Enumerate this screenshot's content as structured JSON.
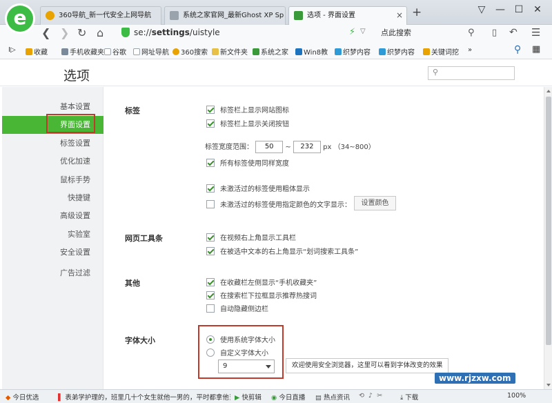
{
  "browser": {
    "logo_letter": "e",
    "tabs": [
      {
        "label": "360导航_新一代安全上网导航",
        "icon_color": "#e8a300"
      },
      {
        "label": "系统之家官网_最新Ghost XP Sp",
        "icon_color": "#9aa3ab"
      },
      {
        "label": "选项 - 界面设置",
        "icon_color": "#3a9a3a"
      }
    ],
    "new_tab_glyph": "+",
    "window_buttons": [
      "▽",
      "—",
      "☐",
      "✕"
    ],
    "address_url_prefix": "se://",
    "address_url_bold": "settings",
    "address_url_suffix": "/uistyle",
    "search_placeholder": "点此搜索"
  },
  "bookmarks": {
    "lead": "I▷",
    "items": [
      {
        "label": "收藏",
        "color": "#e8a300"
      },
      {
        "label": "手机收藏夹",
        "color": "#7a8a9a"
      },
      {
        "label": "谷歌",
        "color": "#9aa3ab"
      },
      {
        "label": "网址导航",
        "color": "#9aa3ab"
      },
      {
        "label": "360搜索",
        "color": "#e8a300"
      },
      {
        "label": "新文件夹",
        "color": "#e8c046"
      },
      {
        "label": "系统之家",
        "color": "#3a9a3a"
      },
      {
        "label": "Win8教",
        "color": "#1e73be"
      },
      {
        "label": "织梦内容",
        "color": "#2e9bd6"
      },
      {
        "label": "织梦内容",
        "color": "#2e9bd6"
      },
      {
        "label": "关键词挖",
        "color": "#e8a300"
      }
    ],
    "more": "»"
  },
  "page": {
    "title": "选项"
  },
  "sidebar": {
    "items": [
      {
        "label": "基本设置"
      },
      {
        "label": "界面设置"
      },
      {
        "label": "标签设置"
      },
      {
        "label": "优化加速"
      },
      {
        "label": "鼠标手势"
      },
      {
        "label": "快捷键"
      },
      {
        "label": "高级设置"
      },
      {
        "label": "实验室"
      },
      {
        "label": "安全设置"
      },
      {
        "label": "广告过滤"
      }
    ],
    "active_index": 1
  },
  "sections": {
    "tabs": {
      "title": "标签",
      "opt1": "标签栏上显示网站图标",
      "opt2": "标签栏上显示关闭按钮",
      "width_label": "标签宽度范围：",
      "width_min": "50",
      "width_sep": "~",
      "width_max": "232",
      "width_unit": "px （34~800）",
      "opt3": "所有标签使用同样宽度",
      "opt4": "未激活过的标签使用粗体显示",
      "opt5": "未激活过的标签使用指定颜色的文字显示：",
      "color_button": "设置颜色"
    },
    "toolbar": {
      "title": "网页工具条",
      "opt1": "在视频右上角显示工具栏",
      "opt2": "在被选中文本的右上角显示“划词搜索工具条”"
    },
    "other": {
      "title": "其他",
      "opt1": "在收藏栏左侧显示“手机收藏夹”",
      "opt2": "在搜索栏下拉框显示推荐热搜词",
      "opt3": "自动隐藏侧边栏"
    },
    "font": {
      "title": "字体大小",
      "opt1": "使用系统字体大小",
      "opt2": "自定义字体大小",
      "size_value": "9",
      "preview": "欢迎使用安全浏览器，这里可以看到字体改变的效果"
    }
  },
  "statusbar": {
    "items": [
      "今日优选",
      "表弟学护理的，班里几十个女生就他一男的，平时都拿他当",
      "快剪辑",
      "今日直播",
      "热点资讯",
      "下载",
      "100%"
    ]
  },
  "watermark": "www.rjzxw.com",
  "colors": {
    "accent": "#4ab636",
    "highlight": "#c0392b"
  }
}
